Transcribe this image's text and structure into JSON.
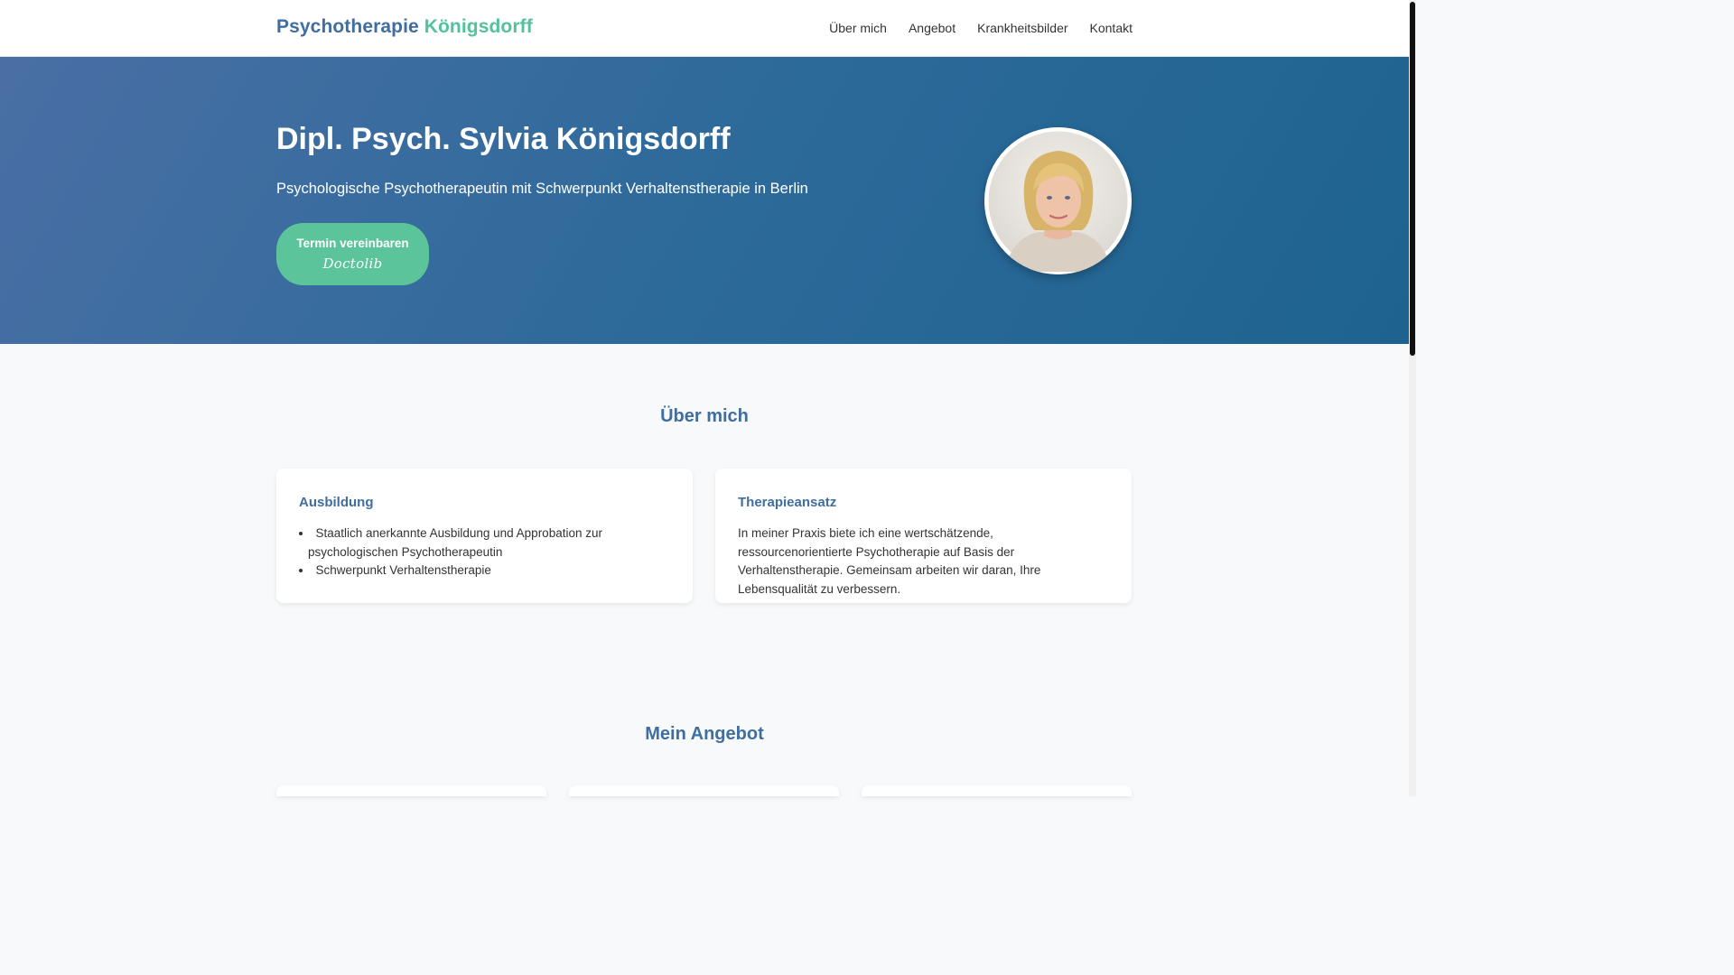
{
  "header": {
    "brand_primary": "Psychotherapie",
    "brand_accent": "Königsdorff",
    "nav": [
      {
        "label": "Über mich"
      },
      {
        "label": "Angebot"
      },
      {
        "label": "Krankheitsbilder"
      },
      {
        "label": "Kontakt"
      }
    ]
  },
  "hero": {
    "title": "Dipl. Psych. Sylvia Königsdorff",
    "subtitle": "Psychologische Psychotherapeutin mit Schwerpunkt Verhaltenstherapie in Berlin",
    "cta_label": "Termin vereinbaren",
    "cta_logo": "Doctolib",
    "avatar_icon": "portrait-photo"
  },
  "about": {
    "title": "Über mich",
    "cards": [
      {
        "title": "Ausbildung",
        "items": [
          "Staatlich anerkannte Ausbildung und Approbation zur psychologischen Psychotherapeutin",
          "Schwerpunkt Verhaltenstherapie"
        ]
      },
      {
        "title": "Therapieansatz",
        "text": "In meiner Praxis biete ich eine wertschätzende, ressourcenorientierte Psychotherapie auf Basis der Verhaltenstherapie. Gemeinsam arbeiten wir daran, Ihre Lebensqualität zu verbessern."
      }
    ]
  },
  "offer": {
    "title": "Mein Angebot"
  },
  "colors": {
    "brand_blue": "#3f6ea0",
    "brand_green": "#52c29a",
    "cta_green": "#5cc49a"
  }
}
